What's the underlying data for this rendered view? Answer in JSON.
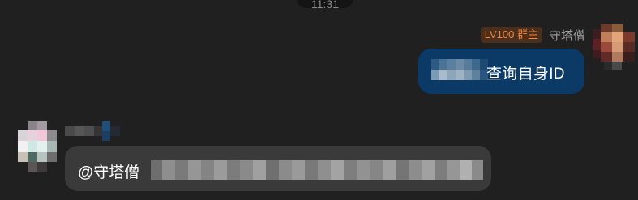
{
  "status": {
    "time": "11:31"
  },
  "outgoing": {
    "badge": "LV100 群主",
    "sender": "守塔僧",
    "avatar_icon": "user-avatar-pixelated",
    "text": "查询自身ID",
    "bubble_color": "#0b3a66"
  },
  "incoming": {
    "avatar_icon": "user-avatar-pixelated",
    "mention": "@守塔僧",
    "bubble_color": "#3a3a3a"
  },
  "colors": {
    "background": "#202020",
    "badge_text": "#f0883e",
    "badge_bg": "#4a2f1e"
  }
}
